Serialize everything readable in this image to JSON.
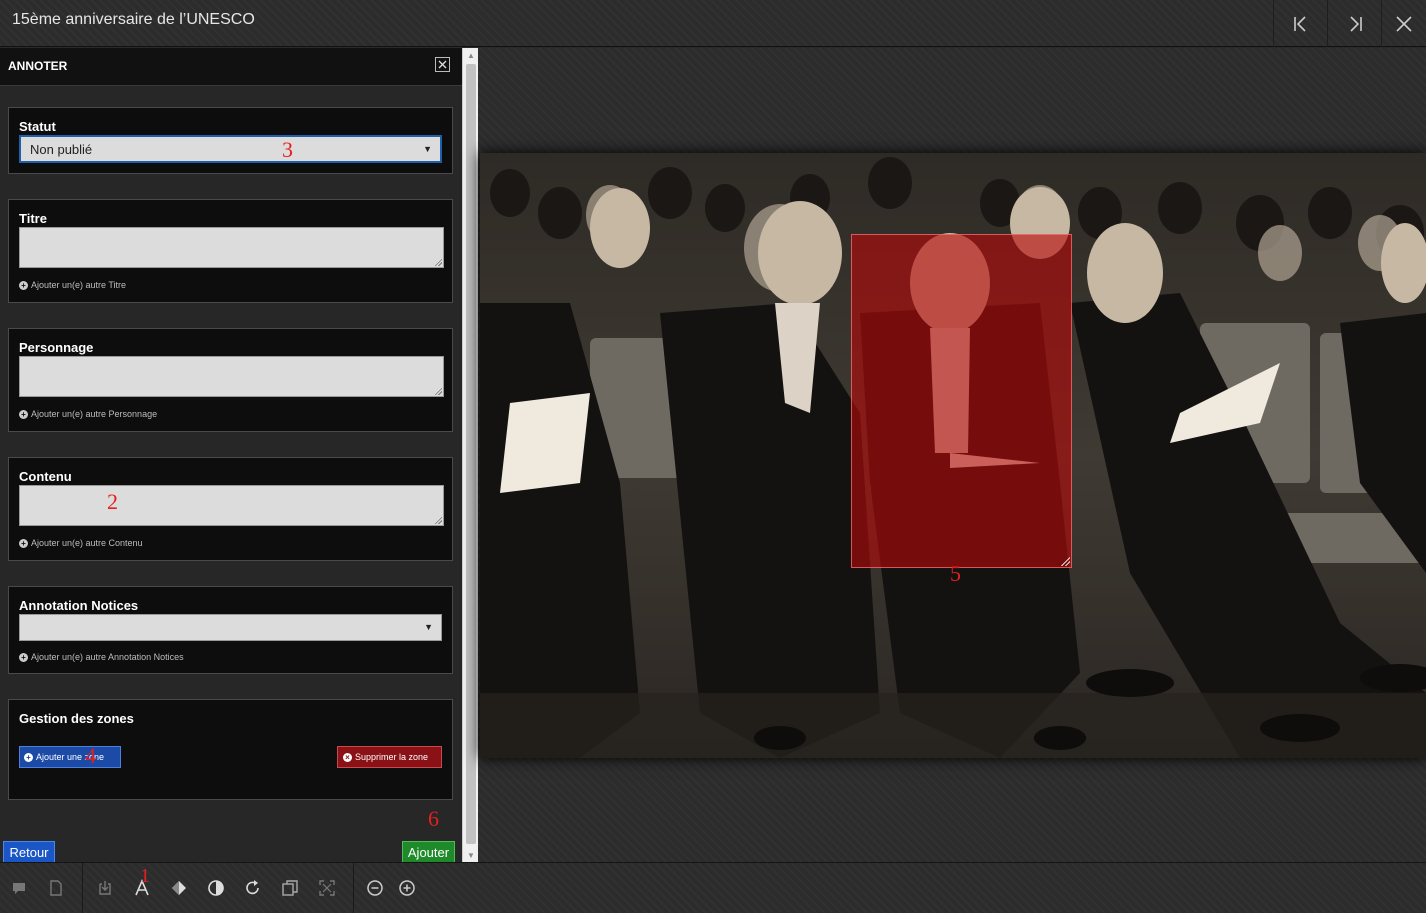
{
  "window": {
    "title": "15ème anniversaire de l’UNESCO"
  },
  "panel": {
    "title": "ANNOTER",
    "statut": {
      "label": "Statut",
      "value": "Non publié"
    },
    "titre": {
      "label": "Titre",
      "value": "",
      "add_label": "Ajouter un(e) autre Titre"
    },
    "personnage": {
      "label": "Personnage",
      "value": "",
      "add_label": "Ajouter un(e) autre Personnage"
    },
    "contenu": {
      "label": "Contenu",
      "value": "",
      "add_label": "Ajouter un(e) autre Contenu"
    },
    "annotation_notices": {
      "label": "Annotation Notices",
      "value": "",
      "add_label": "Ajouter un(e) autre Annotation Notices"
    },
    "zones": {
      "label": "Gestion des zones",
      "add_zone": "Ajouter une zone",
      "delete_zone": "Supprimer la zone"
    },
    "retour": "Retour",
    "ajouter": "Ajouter"
  },
  "markers": {
    "m1": "1",
    "m2": "2",
    "m3": "3",
    "m4": "4",
    "m5": "5",
    "m6": "6"
  },
  "icons": {
    "top": [
      "first-page-icon",
      "last-page-icon",
      "close-icon"
    ],
    "toolbar": [
      "comment-icon",
      "page-icon",
      "download-icon",
      "text-annotate-icon",
      "diamond-icon",
      "contrast-icon",
      "rotate-icon",
      "copy-icon",
      "fullscreen-icon",
      "zoom-out-icon",
      "zoom-in-icon"
    ]
  },
  "colors": {
    "zone": "#b40a0a",
    "primary": "#1a56c5",
    "danger": "#8a1216",
    "success": "#1e8a2a"
  }
}
